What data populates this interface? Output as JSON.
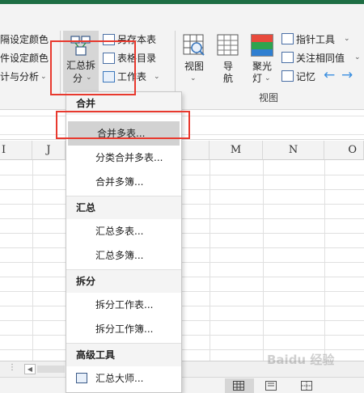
{
  "ribbon": {
    "left_items": [
      "隔设定颜色",
      "件设定颜色",
      "计与分析"
    ],
    "split_button_line1": "汇总拆",
    "split_button_line2": "分",
    "mid_items": [
      "另存本表",
      "表格目录",
      "工作表"
    ],
    "view_button": "视图",
    "nav_button_line1": "导",
    "nav_button_line2": "航",
    "spotlight_line1": "聚光",
    "spotlight_line2": "灯",
    "right_items": [
      "指针工具",
      "关注相同值",
      "记忆"
    ],
    "group_label": "视图"
  },
  "columns": [
    "I",
    "J",
    "M",
    "N",
    "O"
  ],
  "menu": {
    "sections": [
      {
        "header": "合并",
        "items": [
          "合并多表...",
          "分类合并多表...",
          "合并多簿..."
        ]
      },
      {
        "header": "汇总",
        "items": [
          "汇总多表...",
          "汇总多簿..."
        ]
      },
      {
        "header": "拆分",
        "items": [
          "拆分工作表...",
          "拆分工作簿..."
        ]
      },
      {
        "header": "高级工具",
        "items": [
          "汇总大师..."
        ]
      }
    ],
    "highlighted_item": "合并多表..."
  },
  "colors": {
    "highlight_red": "#e8392e",
    "accent_green": "#1e6e44",
    "arrow_blue": "#3b8fe0"
  },
  "watermark": "Baidu 经验"
}
